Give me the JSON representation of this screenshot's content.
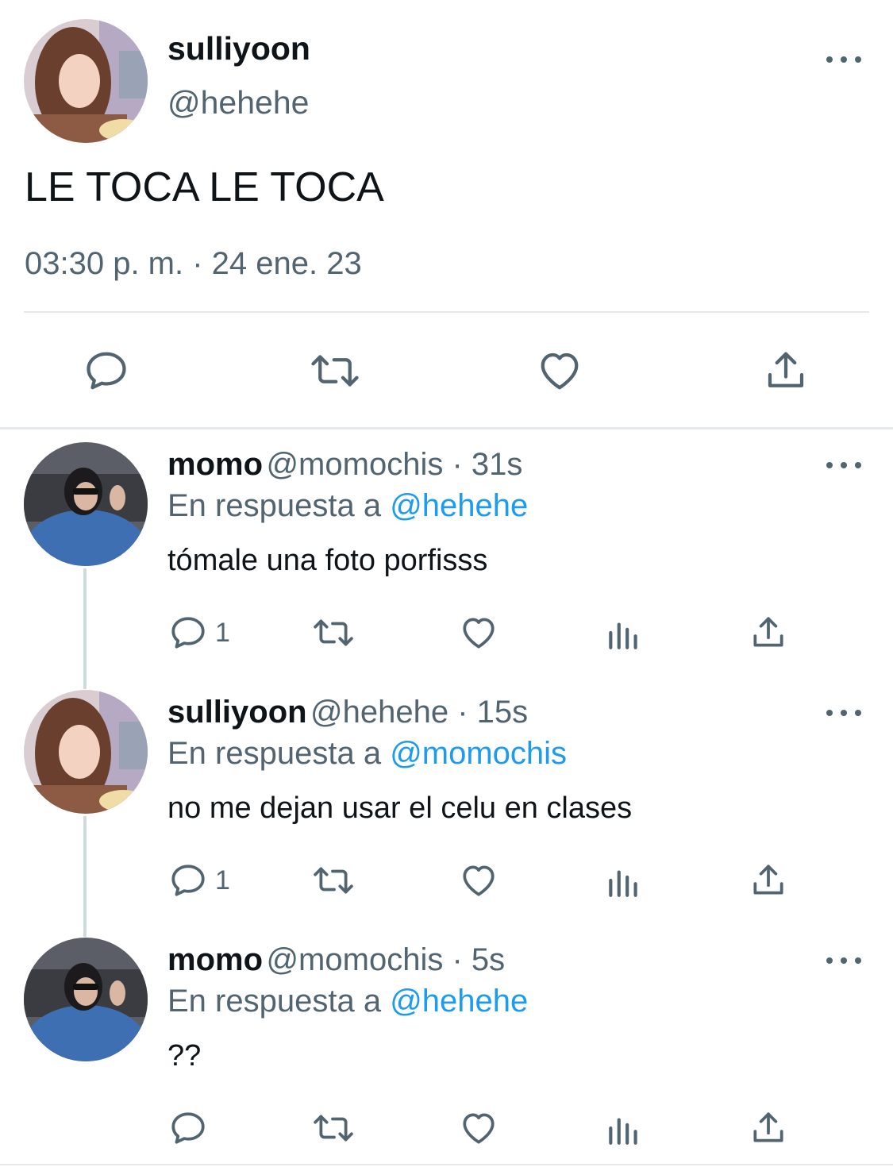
{
  "main_tweet": {
    "display_name": "sulliyoon",
    "handle": "@hehehe",
    "text": "LE TOCA LE TOCA",
    "timestamp": "03:30 p. m. · 24 ene. 23"
  },
  "replies": [
    {
      "display_name": "momo",
      "handle_time": "@momochis · 31s",
      "reply_prefix": "En respuesta a",
      "reply_to": "@hehehe",
      "text": "tómale una foto porfisss",
      "reply_count": "1"
    },
    {
      "display_name": "sulliyoon",
      "handle_time": "@hehehe · 15s",
      "reply_prefix": "En respuesta a",
      "reply_to": "@momochis",
      "text": "no me dejan usar el celu en clases",
      "reply_count": "1"
    },
    {
      "display_name": "momo",
      "handle_time": "@momochis · 5s",
      "reply_prefix": "En respuesta a",
      "reply_to": "@hehehe",
      "text": "??",
      "reply_count": ""
    }
  ],
  "icons": {
    "reply": "reply-icon",
    "retweet": "retweet-icon",
    "like": "like-icon",
    "views": "views-icon",
    "share": "share-icon",
    "more": "more-icon"
  },
  "colors": {
    "text": "#0f1419",
    "secondary": "#536471",
    "link": "#1d9bf0",
    "divider": "#e6e9eb"
  }
}
